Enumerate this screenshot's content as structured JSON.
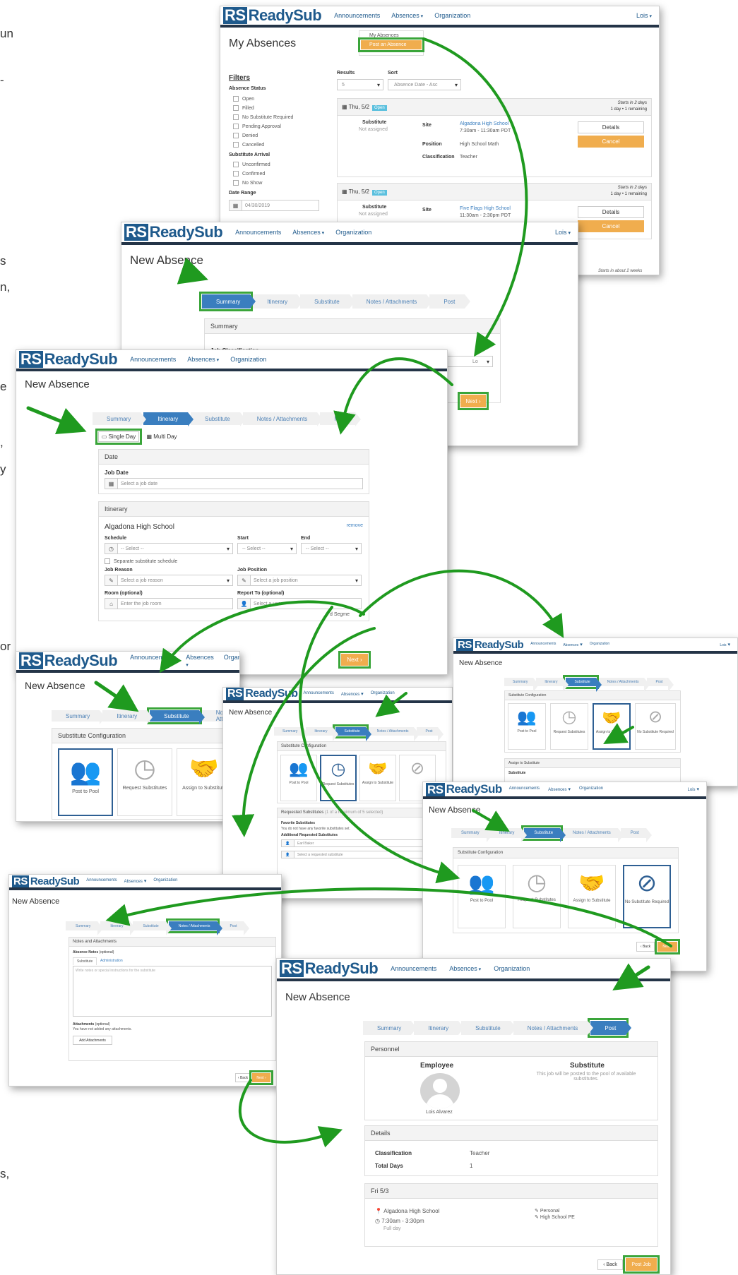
{
  "side_text": [
    "un",
    "-",
    "s",
    "n,",
    "e",
    ",",
    "y",
    "or",
    "s,"
  ],
  "app": {
    "logo_rs": "RS",
    "logo_name": "ReadySub",
    "nav": [
      "Announcements",
      "Absences",
      "Organization"
    ],
    "user": "Lois"
  },
  "my_absences": {
    "title": "My Absences",
    "menu": [
      "My Absences",
      "Post an Absence"
    ],
    "filters_title": "Filters",
    "absence_status_label": "Absence Status",
    "statuses": [
      "Open",
      "Filled",
      "No Substitute Required",
      "Pending Approval",
      "Denied",
      "Cancelled"
    ],
    "arrival_label": "Substitute Arrival",
    "arrivals": [
      "Unconfirmed",
      "Confirmed",
      "No Show"
    ],
    "date_range_label": "Date Range",
    "date_value": "04/30/2019",
    "results_label": "Results",
    "results_value": "5",
    "sort_label": "Sort",
    "sort_value": "Absence Date - Asc",
    "card1": {
      "date": "Thu, 5/2",
      "badge": "Open",
      "starts": "Starts in 2 days",
      "meta": "1 day  •  1 remaining",
      "substitute_label": "Substitute",
      "substitute_value": "Not assigned",
      "site_label": "Site",
      "site_value": "Algadona High School",
      "time": "7:30am - 11:30am PDT",
      "position_label": "Position",
      "position_value": "High School Math",
      "class_label": "Classification",
      "class_value": "Teacher",
      "details": "Details",
      "cancel": "Cancel"
    },
    "card2": {
      "date": "Thu, 5/2",
      "badge": "Open",
      "starts": "Starts in 2 days",
      "meta": "1 day  •  1 remaining",
      "substitute_label": "Substitute",
      "substitute_value": "Not assigned",
      "site_label": "Site",
      "site_value": "Five Flags High School",
      "time": "11:30am - 2:30pm PDT",
      "details": "Details",
      "cancel": "Cancel"
    },
    "card3_starts": "Starts in about 2 weeks"
  },
  "wizard_steps": [
    "Summary",
    "Itinerary",
    "Substitute",
    "Notes / Attachments",
    "Post"
  ],
  "summary_screen": {
    "title": "New Absence",
    "panel_head": "Summary",
    "job_class_label": "Job Classification",
    "select_stub": "Lo",
    "next": "Next"
  },
  "itinerary_screen": {
    "title": "New Absence",
    "single_day": "Single Day",
    "multi_day": "Multi Day",
    "date_head": "Date",
    "job_date_label": "Job Date",
    "job_date_ph": "Select a job date",
    "itinerary_head": "Itinerary",
    "school": "Algadona High School",
    "remove": "remove",
    "schedule_label": "Schedule",
    "start_label": "Start",
    "end_label": "End",
    "select_ph": "-- Select --",
    "separate_schedule": "Separate substitute schedule",
    "job_reason_label": "Job Reason",
    "job_reason_ph": "Select a job reason",
    "job_position_label": "Job Position",
    "job_position_ph": "Select a job position",
    "room_label": "Room (optional)",
    "room_ph": "Enter the job room",
    "report_label": "Report To (optional)",
    "report_ph": "Select a user",
    "add_segment_stub": "d Segme",
    "next": "Next"
  },
  "substitute_screens": {
    "title": "New Absence",
    "config_head": "Substitute Configuration",
    "options": [
      "Post to Pool",
      "Request Substitutes",
      "Assign to Substitute",
      "No Substitute Required"
    ],
    "assign_head": "Assign to Substitute",
    "assign_sub_label": "Substitute",
    "requested_head": "Requested Substitutes",
    "requested_note": "(1 of a maximum of 5 selected)",
    "favorites_label": "Favorite Substitutes",
    "favorites_note": "You do not have any favorite substitutes set.",
    "additional_label": "Additional Requested Substitutes",
    "requested_name": "Earl Baker",
    "requested_ph": "Select a requested substitute",
    "back": "Back",
    "next": "Next"
  },
  "notes_screen": {
    "title": "New Absence",
    "panel_head": "Notes and Attachments",
    "absence_notes_label": "Absence Notes",
    "optional": "(optional)",
    "tabs": [
      "Substitute",
      "Administration"
    ],
    "notes_ph": "Write notes or special instructions for the substitute",
    "attachments_label": "Attachments",
    "attachments_note": "You have not added any attachments.",
    "add_attachments": "Add Attachments",
    "back": "Back",
    "next": "Next"
  },
  "post_screen": {
    "title": "New Absence",
    "personnel_head": "Personnel",
    "employee_label": "Employee",
    "employee_name": "Lois Alvarez",
    "substitute_label": "Substitute",
    "substitute_note": "This job will be posted to the pool of available substitutes.",
    "details_head": "Details",
    "classification_label": "Classification",
    "classification_value": "Teacher",
    "total_days_label": "Total Days",
    "total_days_value": "1",
    "day_head": "Fri 5/3",
    "location": "Algadona High School",
    "time": "7:30am - 3:30pm",
    "full_day": "Full day",
    "reason": "Personal",
    "position": "High School PE",
    "back": "Back",
    "post_job": "Post Job"
  },
  "colors": {
    "nav_dark": "#243447",
    "brand_blue": "#1f5a8c",
    "active_step": "#3a7ebf",
    "orange": "#f0ad4e",
    "highlight_green": "#3aa53a",
    "arrow_green": "#1f9a1f"
  }
}
